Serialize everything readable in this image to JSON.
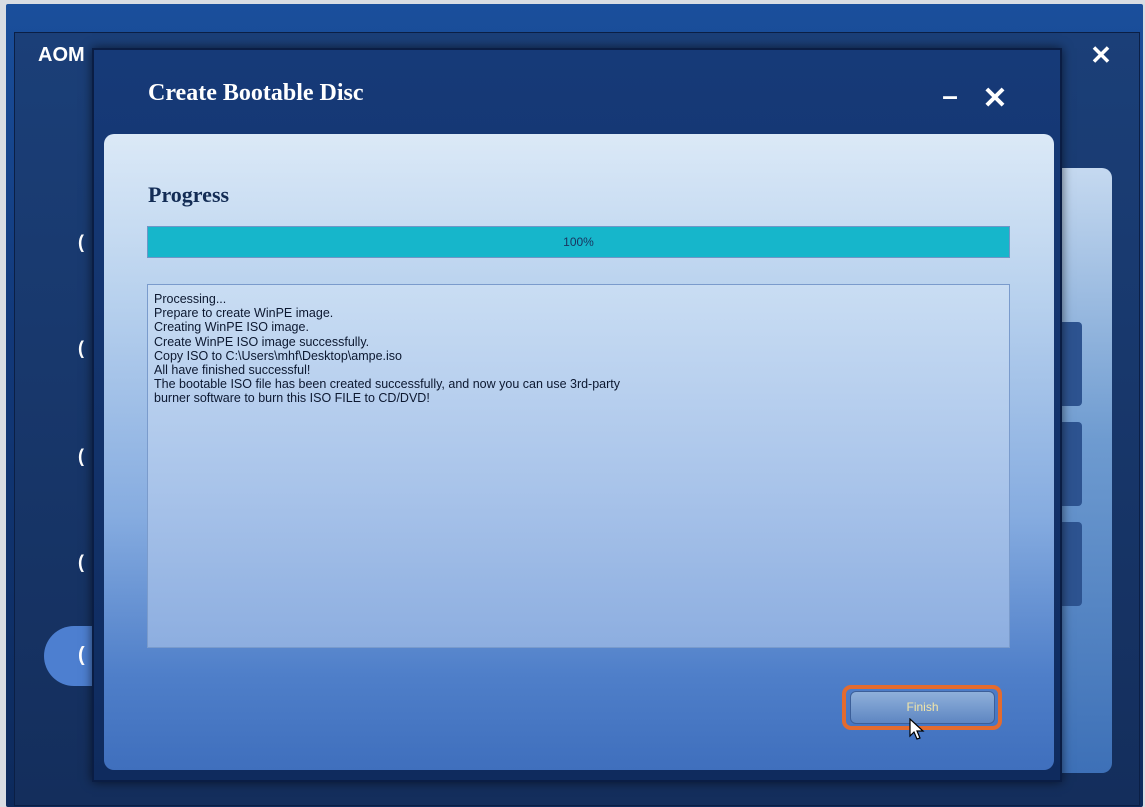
{
  "main_window": {
    "title": "AOM",
    "close_label": "✕",
    "left_items": [
      "(",
      "(",
      "(",
      "(",
      "("
    ]
  },
  "dialog": {
    "title": "Create Bootable Disc",
    "minimize_label": "–",
    "close_label": "✕"
  },
  "progress": {
    "heading": "Progress",
    "percent_text": "100%",
    "percent_value": 100
  },
  "log": {
    "lines": [
      "Processing...",
      "Prepare to create WinPE image.",
      "Creating WinPE ISO image.",
      "Create WinPE ISO image successfully.",
      "Copy ISO to C:\\Users\\mhf\\Desktop\\ampe.iso",
      "All have finished successful!",
      "The bootable ISO file has been created successfully, and now you can use 3rd-party",
      "burner software to burn this ISO FILE to CD/DVD!"
    ]
  },
  "buttons": {
    "finish_label": "Finish"
  },
  "colors": {
    "progress_fill": "#16b6cb",
    "highlight": "#e36b2f"
  }
}
